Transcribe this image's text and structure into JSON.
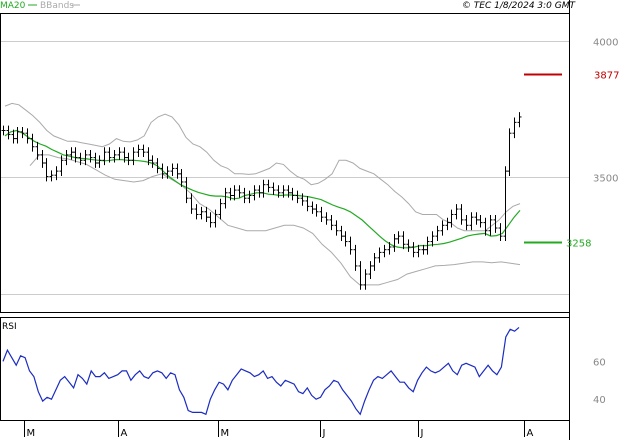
{
  "header": {
    "legend_ma": "MA20",
    "legend_bb": "BBands",
    "stamp": "© TEC 1/8/2024 3:0 GMT"
  },
  "colors": {
    "ma": "#22aa22",
    "bands": "#aaaaaa",
    "price": "#000000",
    "rsi": "#1b2cc1",
    "resistance": "#c00000",
    "support": "#22aa22",
    "grid": "#cccccc",
    "axis_text": "#888888"
  },
  "chart_data": [
    {
      "type": "line",
      "name": "price-panel",
      "title": "",
      "x": [
        "M",
        "A",
        "M",
        "J",
        "J",
        "A"
      ],
      "ylim": [
        3000,
        4100
      ],
      "yticks": [
        {
          "value": 4000,
          "label": "4000"
        },
        {
          "value": 3500,
          "label": "3500"
        }
      ],
      "grid": true,
      "levels": [
        {
          "name": "resistance",
          "value": 3877,
          "label": "3877"
        },
        {
          "name": "support",
          "value": 3258,
          "label": "3258"
        }
      ],
      "close": [
        3670,
        3655,
        3640,
        3665,
        3660,
        3640,
        3610,
        3580,
        3550,
        3500,
        3505,
        3520,
        3560,
        3580,
        3590,
        3570,
        3560,
        3580,
        3570,
        3550,
        3560,
        3590,
        3570,
        3580,
        3590,
        3570,
        3560,
        3590,
        3600,
        3590,
        3560,
        3550,
        3530,
        3510,
        3520,
        3530,
        3510,
        3480,
        3420,
        3380,
        3360,
        3370,
        3350,
        3330,
        3360,
        3400,
        3440,
        3430,
        3450,
        3440,
        3420,
        3430,
        3450,
        3440,
        3470,
        3460,
        3450,
        3440,
        3450,
        3440,
        3430,
        3420,
        3410,
        3390,
        3380,
        3370,
        3350,
        3340,
        3320,
        3300,
        3280,
        3260,
        3230,
        3170,
        3100,
        3140,
        3170,
        3200,
        3220,
        3230,
        3240,
        3270,
        3280,
        3250,
        3240,
        3220,
        3230,
        3230,
        3260,
        3280,
        3300,
        3320,
        3330,
        3360,
        3380,
        3340,
        3320,
        3350,
        3340,
        3330,
        3300,
        3340,
        3310,
        3280,
        3520,
        3660,
        3700,
        3720
      ],
      "ma20": [
        3650,
        3665,
        3670,
        3660,
        3645,
        3630,
        3620,
        3612,
        3600,
        3590,
        3580,
        3575,
        3570,
        3567,
        3565,
        3562,
        3560,
        3558,
        3560,
        3563,
        3562,
        3560,
        3560,
        3558,
        3555,
        3550,
        3540,
        3520,
        3500,
        3485,
        3470,
        3460,
        3450,
        3442,
        3436,
        3430,
        3428,
        3428,
        3425,
        3418,
        3420,
        3430,
        3435,
        3440,
        3440,
        3435,
        3433,
        3430,
        3432,
        3432,
        3430,
        3428,
        3425,
        3420,
        3415,
        3405,
        3395,
        3387,
        3380,
        3370,
        3355,
        3340,
        3320,
        3300,
        3280,
        3262,
        3248,
        3240,
        3237,
        3237,
        3240,
        3245,
        3245,
        3248,
        3250,
        3253,
        3258,
        3265,
        3272,
        3280,
        3285,
        3288,
        3290,
        3280,
        3282,
        3290,
        3320,
        3350,
        3375
      ],
      "bb_upper": [
        3760,
        3770,
        3765,
        3745,
        3725,
        3700,
        3670,
        3650,
        3640,
        3630,
        3630,
        3625,
        3620,
        3615,
        3610,
        3620,
        3640,
        3630,
        3628,
        3635,
        3650,
        3700,
        3720,
        3730,
        3720,
        3690,
        3645,
        3620,
        3610,
        3590,
        3560,
        3540,
        3530,
        3510,
        3510,
        3508,
        3510,
        3520,
        3530,
        3550,
        3545,
        3520,
        3500,
        3490,
        3470,
        3475,
        3490,
        3510,
        3560,
        3560,
        3550,
        3530,
        3520,
        3510,
        3490,
        3470,
        3445,
        3425,
        3400,
        3370,
        3360,
        3360,
        3360,
        3340,
        3330,
        3310,
        3300,
        3300,
        3300,
        3300,
        3320,
        3340,
        3370,
        3390,
        3400
      ],
      "bb_lower": [
        3540,
        3580,
        3580,
        3570,
        3565,
        3555,
        3545,
        3525,
        3505,
        3490,
        3485,
        3480,
        3485,
        3500,
        3510,
        3490,
        3470,
        3440,
        3400,
        3380,
        3350,
        3320,
        3310,
        3300,
        3300,
        3300,
        3310,
        3320,
        3320,
        3310,
        3290,
        3250,
        3220,
        3180,
        3130,
        3100,
        3100,
        3100,
        3110,
        3120,
        3140,
        3150,
        3160,
        3170,
        3172,
        3175,
        3180,
        3185,
        3185,
        3182,
        3185,
        3180,
        3175
      ]
    },
    {
      "type": "line",
      "name": "rsi-panel",
      "title": "RSI",
      "ylim": [
        29,
        83
      ],
      "yticks": [
        {
          "value": 60,
          "label": "60"
        },
        {
          "value": 40,
          "label": "40"
        }
      ],
      "values": [
        60,
        66,
        62,
        58,
        63,
        62,
        55,
        52,
        44,
        39,
        41,
        40,
        45,
        50,
        52,
        49,
        46,
        53,
        51,
        48,
        55,
        52,
        52,
        54,
        51,
        52,
        53,
        55,
        55,
        50,
        53,
        55,
        52,
        51,
        54,
        55,
        54,
        51,
        54,
        53,
        45,
        41,
        34,
        33,
        33,
        33,
        32,
        40,
        45,
        49,
        48,
        45,
        50,
        53,
        56,
        55,
        54,
        52,
        53,
        55,
        51,
        52,
        49,
        47,
        50,
        49,
        48,
        44,
        43,
        46,
        42,
        40,
        41,
        45,
        47,
        50,
        49,
        45,
        42,
        39,
        35,
        32,
        39,
        45,
        50,
        52,
        51,
        53,
        55,
        52,
        49,
        49,
        46,
        44,
        50,
        54,
        57,
        55,
        54,
        55,
        57,
        59,
        55,
        53,
        58,
        59,
        58,
        57,
        52,
        55,
        58,
        55,
        53,
        57,
        73,
        77,
        76,
        78
      ]
    }
  ],
  "x_axis": {
    "ticks": [
      "M",
      "A",
      "M",
      "J",
      "J",
      "A"
    ]
  }
}
